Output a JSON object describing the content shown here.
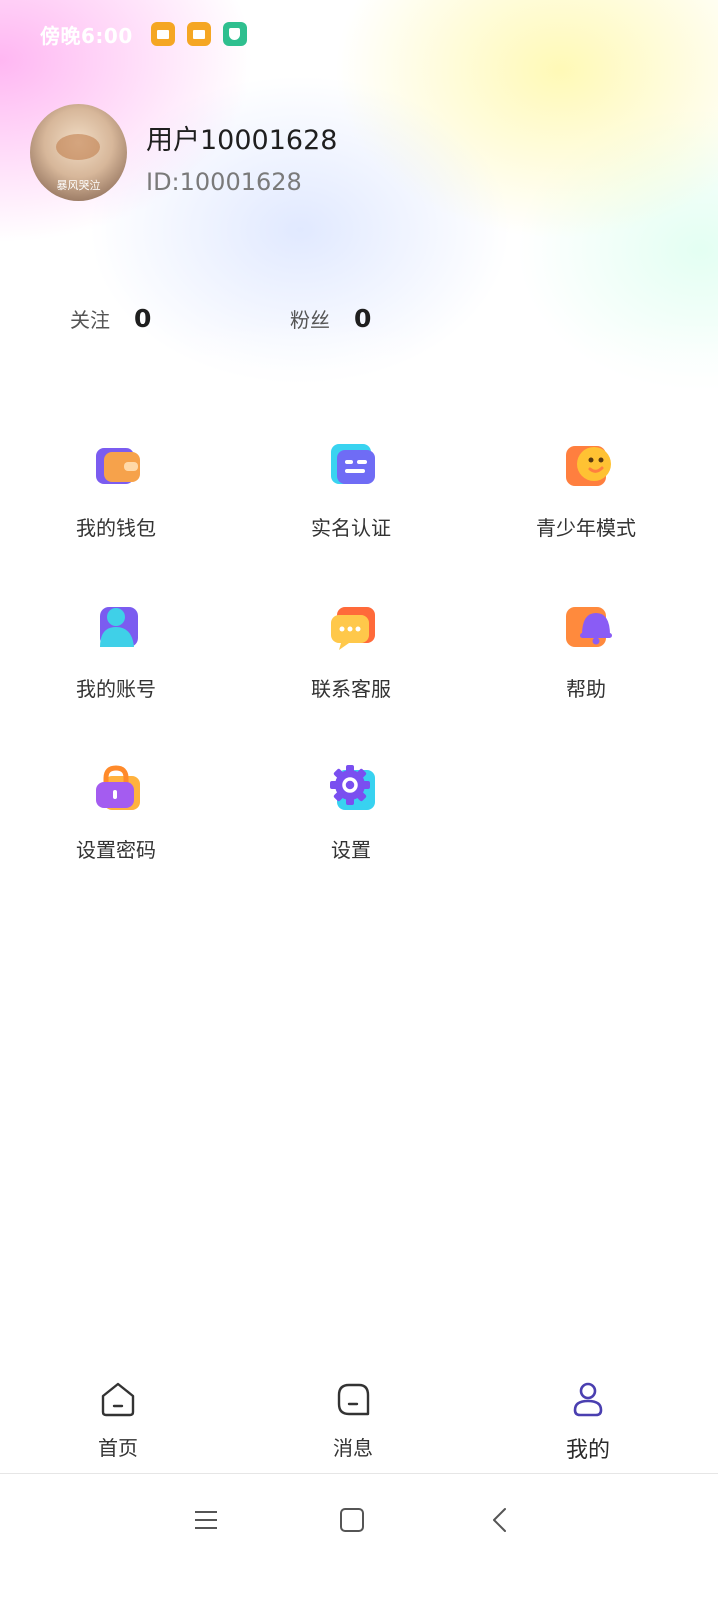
{
  "status_bar": {
    "time": "傍晚6:00",
    "icons": [
      "message-icon",
      "message-icon",
      "shield-icon"
    ],
    "more": "···"
  },
  "profile": {
    "avatar_caption": "暴风哭泣",
    "username": "用户10001628",
    "user_id": "ID:10001628"
  },
  "stats": [
    {
      "label": "关注",
      "value": "0"
    },
    {
      "label": "粉丝",
      "value": "0"
    }
  ],
  "menu": [
    {
      "label": "我的钱包",
      "icon": "wallet-icon"
    },
    {
      "label": "实名认证",
      "icon": "id-card-icon"
    },
    {
      "label": "青少年模式",
      "icon": "teen-mode-icon"
    },
    {
      "label": "我的账号",
      "icon": "account-icon"
    },
    {
      "label": "联系客服",
      "icon": "customer-service-icon"
    },
    {
      "label": "帮助",
      "icon": "help-bell-icon"
    },
    {
      "label": "设置密码",
      "icon": "lock-icon"
    },
    {
      "label": "设置",
      "icon": "gear-icon"
    }
  ],
  "tabs": [
    {
      "label": "首页",
      "icon": "home-icon"
    },
    {
      "label": "消息",
      "icon": "message-icon"
    },
    {
      "label": "我的",
      "icon": "user-icon",
      "active": true
    }
  ],
  "system_nav": [
    "menu-icon",
    "home-square-icon",
    "back-icon"
  ],
  "colors": {
    "accent": "#4a3fb0",
    "wallet_front": "#f6a24b",
    "wallet_back": "#7b5cf0",
    "idcard_front": "#6f6cf5",
    "idcard_back": "#39d3f0",
    "teen_back": "#ff7f3f",
    "teen_front": "#ffc233"
  }
}
